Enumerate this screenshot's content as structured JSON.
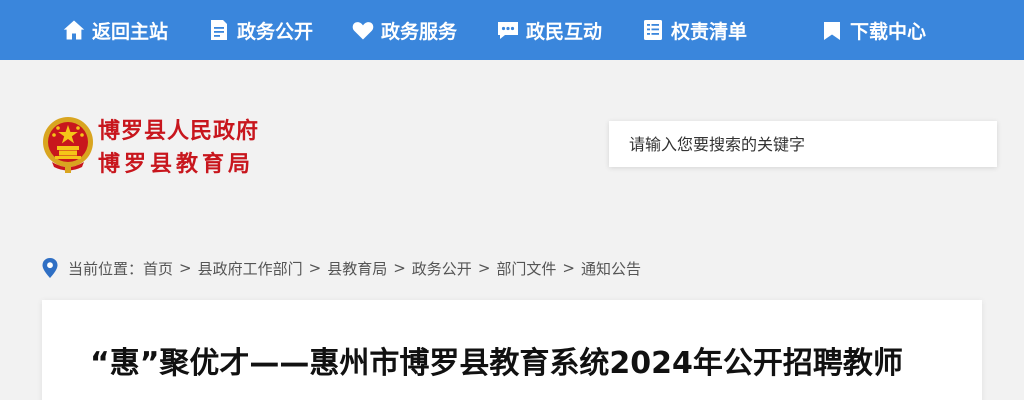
{
  "nav": {
    "items": [
      {
        "label": "返回主站",
        "icon": "home-icon"
      },
      {
        "label": "政务公开",
        "icon": "document-icon"
      },
      {
        "label": "政务服务",
        "icon": "heart-icon"
      },
      {
        "label": "政民互动",
        "icon": "chat-icon"
      },
      {
        "label": "权责清单",
        "icon": "list-icon"
      },
      {
        "label": "下载中心",
        "icon": "bookmark-icon"
      }
    ]
  },
  "header": {
    "logo_line1": "博罗县人民政府",
    "logo_line2": "博罗县教育局",
    "emblem_icon": "national-emblem-icon",
    "search_placeholder": "请输入您要搜索的关键字"
  },
  "breadcrumb": {
    "prefix": "当前位置：",
    "separator": ">",
    "items": [
      "首页",
      "县政府工作部门",
      "县教育局",
      "政务公开",
      "部门文件",
      "通知公告"
    ]
  },
  "article": {
    "title": "“惠”聚优才——惠州市博罗县教育系统2024年公开招聘教师"
  },
  "colors": {
    "nav_bg": "#3a86dc",
    "logo_red": "#c8161d",
    "page_bg": "#f2f2f2"
  }
}
